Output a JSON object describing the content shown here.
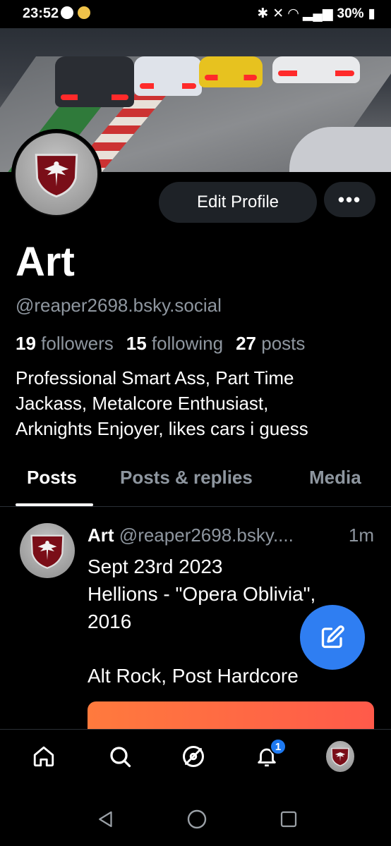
{
  "status_bar": {
    "time": "23:52",
    "battery": "30%"
  },
  "profile": {
    "edit_button": "Edit Profile",
    "more_button": "•••",
    "display_name": "Art",
    "handle": "@reaper2698.bsky.social",
    "followers_count": "19",
    "followers_label": "followers",
    "following_count": "15",
    "following_label": "following",
    "posts_count": "27",
    "posts_label": "posts",
    "bio_lines": [
      "Professional Smart Ass, Part Time",
      "Jackass, Metalcore Enthusiast,",
      "Arknights Enjoyer, likes cars i guess"
    ]
  },
  "tabs": [
    {
      "label": "Posts",
      "active": true
    },
    {
      "label": "Posts & replies",
      "active": false
    },
    {
      "label": "Media",
      "active": false
    }
  ],
  "post": {
    "author": "Art",
    "handle": "@reaper2698.bsky....",
    "time": "1m",
    "lines": [
      "Sept 23rd 2023",
      "Hellions - \"Opera Oblivia\",",
      "2016",
      "",
      "Alt Rock, Post Hardcore"
    ]
  },
  "bottom_nav": {
    "notifications_badge": "1"
  },
  "colors": {
    "accent": "#2f7ef2",
    "muted_text": "#8e969f",
    "button_bg": "#1e2227"
  }
}
